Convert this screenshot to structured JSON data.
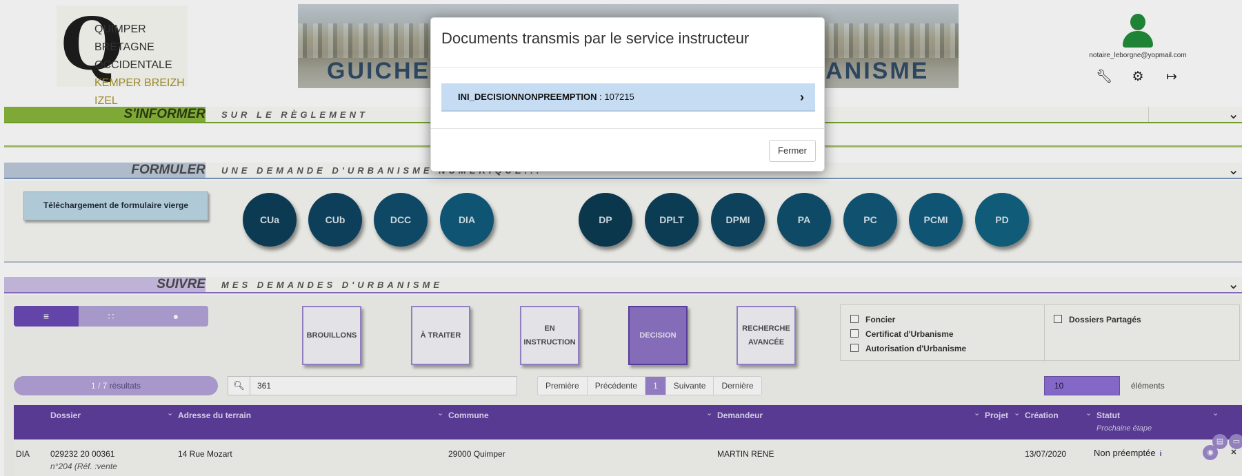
{
  "logo": {
    "line1": "QUIMPER BRETAGNE",
    "line2": "OCCIDENTALE",
    "line3": "KEMPER BREIZH IZEL",
    "mark": "Q"
  },
  "banner": {
    "title_left": "GUICHET U",
    "title_right": "RBANISME"
  },
  "user": {
    "email": "notaire_leborgne@yopmail.com",
    "icons": [
      "wrench-icon",
      "gear-icon",
      "sign-out-icon"
    ]
  },
  "sections": {
    "informer": {
      "label": "S'INFORMER",
      "desc": "SUR LE RÈGLEMENT"
    },
    "formuler": {
      "label": "FORMULER",
      "desc": "UNE DEMANDE D'URBANISME NUMÉRIQUE..."
    },
    "suivre": {
      "label": "SUIVRE",
      "desc": "MES DEMANDES D'URBANISME"
    }
  },
  "formuler": {
    "blank_form_label": "Téléchargement de formulaire vierge",
    "types": [
      "CUa",
      "CUb",
      "DCC",
      "DIA",
      "DP",
      "DPLT",
      "DPMI",
      "PA",
      "PC",
      "PCMI",
      "PD"
    ]
  },
  "suivre": {
    "view_modes": [
      "list-icon",
      "grid-icon",
      "map-marker-icon"
    ],
    "status_buttons": [
      "BROUILLONS",
      "À TRAITER",
      "EN INSTRUCTION",
      "DECISION",
      "RECHERCHE AVANCÉE"
    ],
    "active_status": "DECISION",
    "filters": {
      "left": [
        "Foncier",
        "Certificat d'Urbanisme",
        "Autorisation d'Urbanisme"
      ],
      "right": [
        "Dossiers Partagés"
      ]
    },
    "result_count": "1 / 7",
    "result_label": "résultats",
    "search_value": "361",
    "pager": {
      "first": "Première",
      "prev": "Précédente",
      "current": "1",
      "next": "Suivante",
      "last": "Dernière"
    },
    "per_page": "10",
    "per_page_label": "éléments"
  },
  "table": {
    "columns": [
      "Dossier",
      "Adresse du terrain",
      "Commune",
      "Demandeur",
      "Projet",
      "Création",
      "Statut"
    ],
    "status_subheader": "Prochaine étape",
    "rows": [
      {
        "type": "DIA",
        "dossier": "029232 20 00361",
        "dossier_sub": "n°204 (Réf. :vente",
        "adresse": "14 Rue Mozart",
        "commune": "29000 Quimper",
        "demandeur": "MARTIN RENE",
        "creation": "13/07/2020",
        "statut": "Non préemptée"
      }
    ]
  },
  "modal": {
    "title": "Documents transmis par le service instructeur",
    "items": [
      {
        "code": "INI_DECISIONNONPREEMPTION",
        "value": " : 107215"
      }
    ],
    "close_label": "Fermer"
  },
  "colors": {
    "informer": "#88b63a",
    "suivre_header": "#5e3d9e",
    "modal_item": "#c6dcf2",
    "circles": [
      "#0b3d57",
      "#0e4d6b",
      "#0a4463",
      "#0f5a7a"
    ]
  }
}
